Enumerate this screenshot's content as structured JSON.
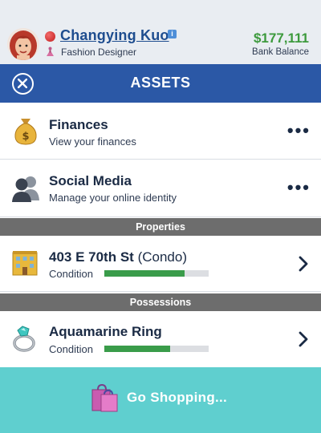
{
  "header": {
    "player_name": "Changying Kuo",
    "info_badge": "i",
    "job_title": "Fashion Designer",
    "balance": "$177,111",
    "balance_label": "Bank Balance"
  },
  "titlebar": {
    "title": "ASSETS"
  },
  "menu": [
    {
      "title": "Finances",
      "subtitle": "View your finances",
      "icon": "money-bag-icon"
    },
    {
      "title": "Social Media",
      "subtitle": "Manage your online identity",
      "icon": "people-icon"
    }
  ],
  "properties": {
    "section_label": "Properties",
    "items": [
      {
        "title": "403 E 70th St",
        "suffix": "(Condo)",
        "condition_label": "Condition",
        "condition": 0.77,
        "icon": "building-icon"
      }
    ]
  },
  "possessions": {
    "section_label": "Possessions",
    "items": [
      {
        "title": "Aquamarine Ring",
        "condition_label": "Condition",
        "condition": 0.63,
        "icon": "ring-icon"
      }
    ]
  },
  "footer": {
    "shop_label": "Go Shopping...",
    "icon": "shopping-bag-icon"
  },
  "more_glyph": "•••",
  "colors": {
    "header_bg": "#e9edf2",
    "titlebar_bg": "#2b58a6",
    "balance": "#3d9a3d",
    "condition_bar": "#3a9c4a",
    "section_bg": "#6d6d6d",
    "shop_bg": "#5fcfcf"
  }
}
